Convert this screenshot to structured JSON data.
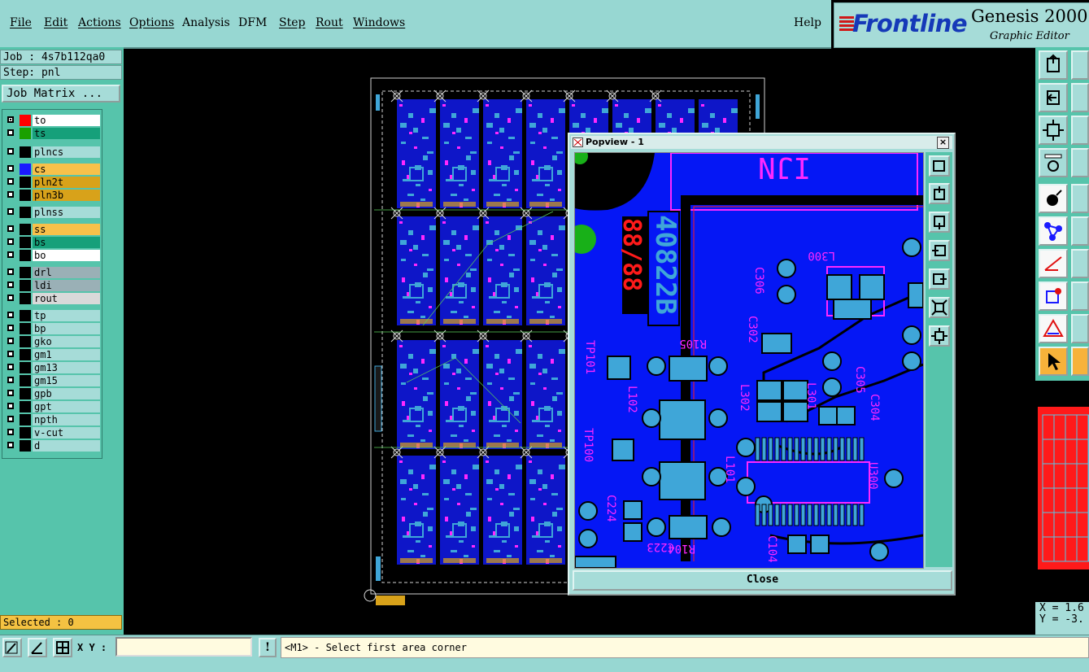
{
  "menu": {
    "file": "File",
    "edit": "Edit",
    "actions": "Actions",
    "options": "Options",
    "analysis": "Analysis",
    "dfm": "DFM",
    "step": "Step",
    "rout": "Rout",
    "windows": "Windows",
    "help": "Help"
  },
  "logo": {
    "brand": "Frontline",
    "product": "Genesis 2000",
    "subtitle": "Graphic Editor"
  },
  "job": {
    "job_line": "Job : 4s7b112qa0",
    "step_line": "Step: pnl",
    "matrix_button": "Job Matrix ..."
  },
  "layers": [
    {
      "name": "to",
      "color": "#ff0000",
      "checked": true,
      "bg": "#ffffff"
    },
    {
      "name": "ts",
      "color": "#1aa000",
      "checked": false,
      "bg": "#16a07a"
    },
    {
      "name": "plncs",
      "color": "#000000",
      "checked": false,
      "bg": "#a6dcd8"
    },
    {
      "name": "cs",
      "color": "#1a1aff",
      "checked": false,
      "bg": "#f7c14a"
    },
    {
      "name": "pln2t",
      "color": "#000000",
      "checked": false,
      "bg": "#d8a21a"
    },
    {
      "name": "pln3b",
      "color": "#000000",
      "checked": false,
      "bg": "#d8a21a"
    },
    {
      "name": "plnss",
      "color": "#000000",
      "checked": false,
      "bg": "#a6dcd8"
    },
    {
      "name": "ss",
      "color": "#000000",
      "checked": false,
      "bg": "#f7c14a"
    },
    {
      "name": "bs",
      "color": "#000000",
      "checked": false,
      "bg": "#16a07a"
    },
    {
      "name": "bo",
      "color": "#000000",
      "checked": false,
      "bg": "#ffffff"
    },
    {
      "name": "drl",
      "color": "#000000",
      "checked": false,
      "bg": "#9ab0b6"
    },
    {
      "name": "ldi",
      "color": "#000000",
      "checked": false,
      "bg": "#9ab0b6"
    },
    {
      "name": "rout",
      "color": "#000000",
      "checked": false,
      "bg": "#d9d9d9"
    },
    {
      "name": "tp",
      "color": "#000000",
      "checked": false,
      "bg": "#a6dcd8"
    },
    {
      "name": "bp",
      "color": "#000000",
      "checked": false,
      "bg": "#a6dcd8"
    },
    {
      "name": "gko",
      "color": "#000000",
      "checked": false,
      "bg": "#a6dcd8"
    },
    {
      "name": "gm1",
      "color": "#000000",
      "checked": false,
      "bg": "#a6dcd8"
    },
    {
      "name": "gm13",
      "color": "#000000",
      "checked": false,
      "bg": "#a6dcd8"
    },
    {
      "name": "gm15",
      "color": "#000000",
      "checked": false,
      "bg": "#a6dcd8"
    },
    {
      "name": "gpb",
      "color": "#000000",
      "checked": false,
      "bg": "#a6dcd8"
    },
    {
      "name": "gpt",
      "color": "#000000",
      "checked": false,
      "bg": "#a6dcd8"
    },
    {
      "name": "npth",
      "color": "#000000",
      "checked": false,
      "bg": "#a6dcd8"
    },
    {
      "name": "v-cut",
      "color": "#000000",
      "checked": false,
      "bg": "#a6dcd8"
    },
    {
      "name": "d",
      "color": "#000000",
      "checked": false,
      "bg": "#a6dcd8"
    }
  ],
  "status": {
    "selected": "Selected : 0",
    "xy_label": "X Y :",
    "xy_value": "",
    "excl": "!",
    "prompt": "<M1> - Select first area corner"
  },
  "coords": {
    "x": "X = 1.6",
    "y": "Y = -3."
  },
  "popview": {
    "title": "Popview - 1",
    "close_x": "×",
    "close_button": "Close",
    "labels": [
      "C306",
      "L300",
      "C302",
      "R105",
      "C305",
      "TP101",
      "L302",
      "L301",
      "C304",
      "L102",
      "TP100",
      "L101",
      "U300",
      "C224",
      "R104",
      "C223",
      "C104"
    ],
    "vertical_code": "40822B",
    "date_code": "88/88",
    "top_text": "IJN"
  },
  "colors": {
    "board_blue": "#0517f5",
    "pad": "#3fa6d8",
    "magenta": "#ff28ff",
    "panel_teal": "#56c4ab",
    "menu_teal": "#97d7d2"
  }
}
